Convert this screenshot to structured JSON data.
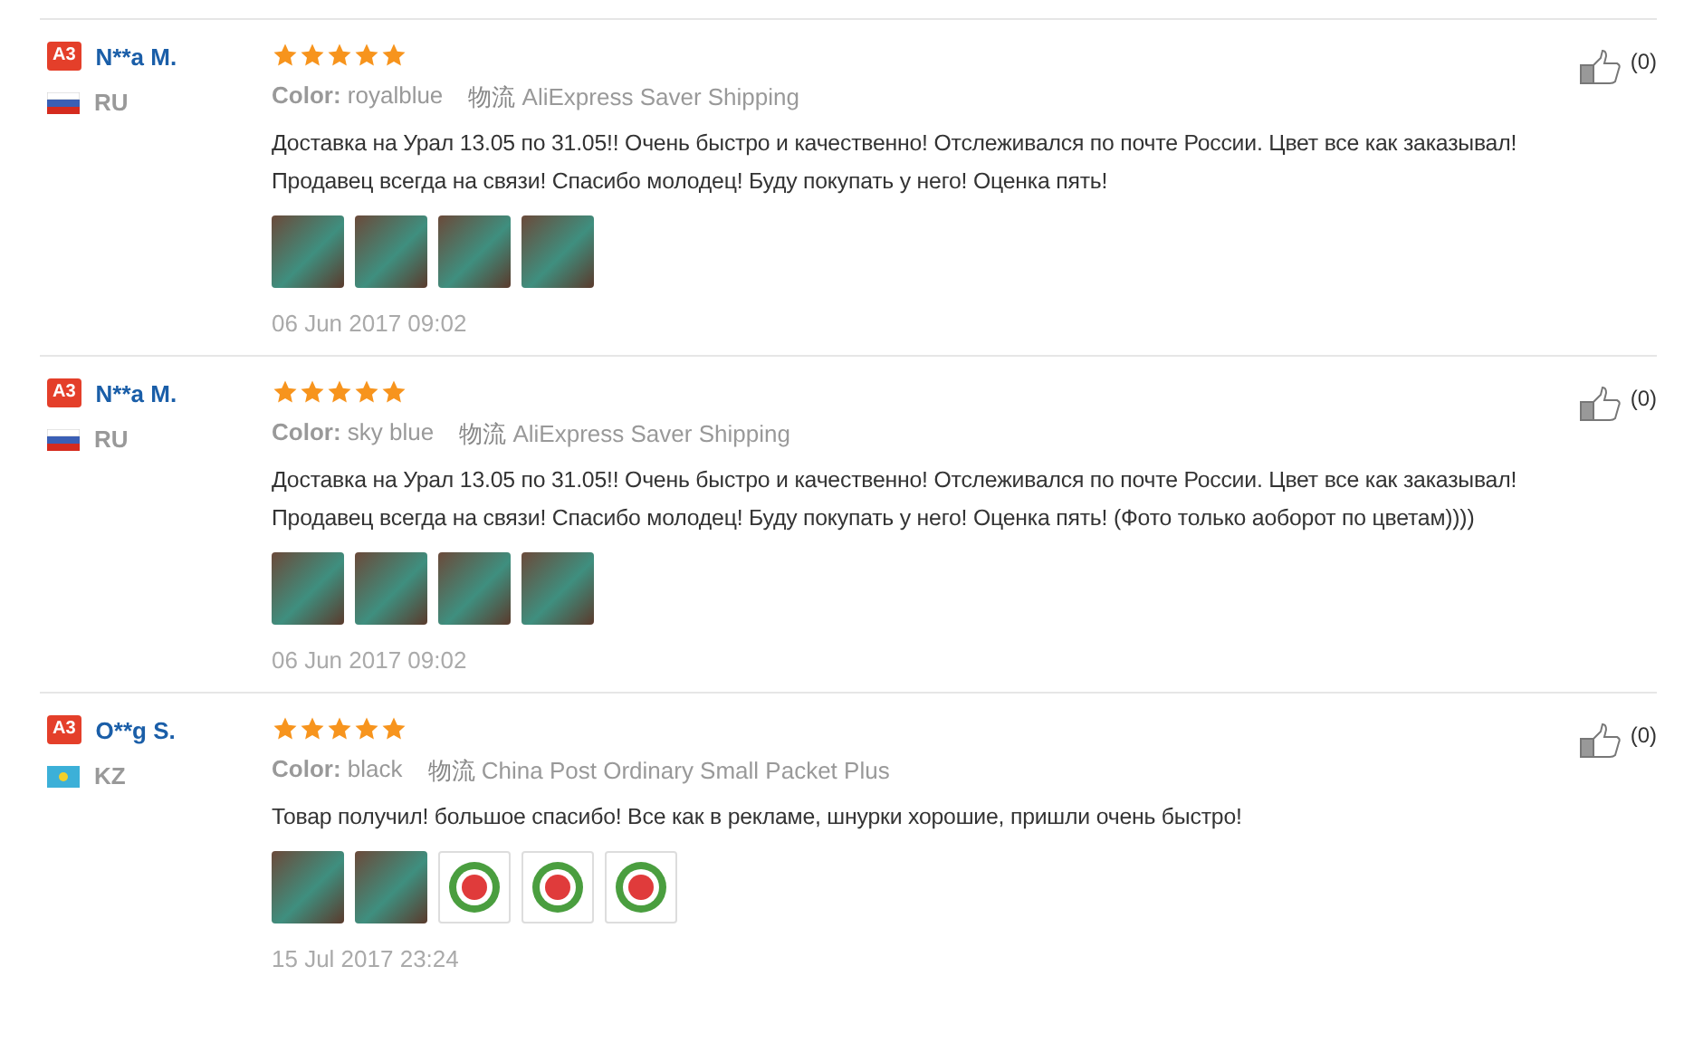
{
  "reviews": [
    {
      "badge": "A3",
      "name": "N**a M.",
      "flag": {
        "kind": "ru"
      },
      "country": "RU",
      "stars": 5,
      "color_label": "Color:",
      "color_value": "royalblue",
      "shipping_label": "物流",
      "shipping_value": "AliExpress Saver Shipping",
      "text": "Доставка на Урал 13.05 по 31.05!! Очень быстро и качественно! Отслеживался по почте России. Цвет все как заказывал! Продавец всегда на связи! Спасибо молодец! Буду покупать у него! Оценка пять!",
      "photos": [
        {
          "kind": "photo"
        },
        {
          "kind": "photo"
        },
        {
          "kind": "photo"
        },
        {
          "kind": "photo"
        }
      ],
      "date": "06 Jun 2017 09:02",
      "likes": "(0)"
    },
    {
      "badge": "A3",
      "name": "N**a M.",
      "flag": {
        "kind": "ru"
      },
      "country": "RU",
      "stars": 5,
      "color_label": "Color:",
      "color_value": "sky blue",
      "shipping_label": "物流",
      "shipping_value": "AliExpress Saver Shipping",
      "text": "Доставка на Урал 13.05 по 31.05!! Очень быстро и качественно! Отслеживался по почте России. Цвет все как заказывал! Продавец всегда на связи! Спасибо молодец! Буду покупать у него! Оценка пять! (Фото только аоборот по цветам))))",
      "photos": [
        {
          "kind": "photo"
        },
        {
          "kind": "photo"
        },
        {
          "kind": "photo"
        },
        {
          "kind": "photo"
        }
      ],
      "date": "06 Jun 2017 09:02",
      "likes": "(0)"
    },
    {
      "badge": "A3",
      "name": "O**g S.",
      "flag": {
        "kind": "kz"
      },
      "country": "KZ",
      "stars": 5,
      "color_label": "Color:",
      "color_value": "black",
      "shipping_label": "物流",
      "shipping_value": "China Post Ordinary Small Packet Plus",
      "text": "Товар получил! большое спасибо! Все как в рекламе, шнурки хорошие, пришли очень быстро!",
      "photos": [
        {
          "kind": "photo"
        },
        {
          "kind": "photo"
        },
        {
          "kind": "sticker"
        },
        {
          "kind": "sticker"
        },
        {
          "kind": "sticker"
        }
      ],
      "date": "15 Jul 2017 23:24",
      "likes": "(0)"
    }
  ]
}
